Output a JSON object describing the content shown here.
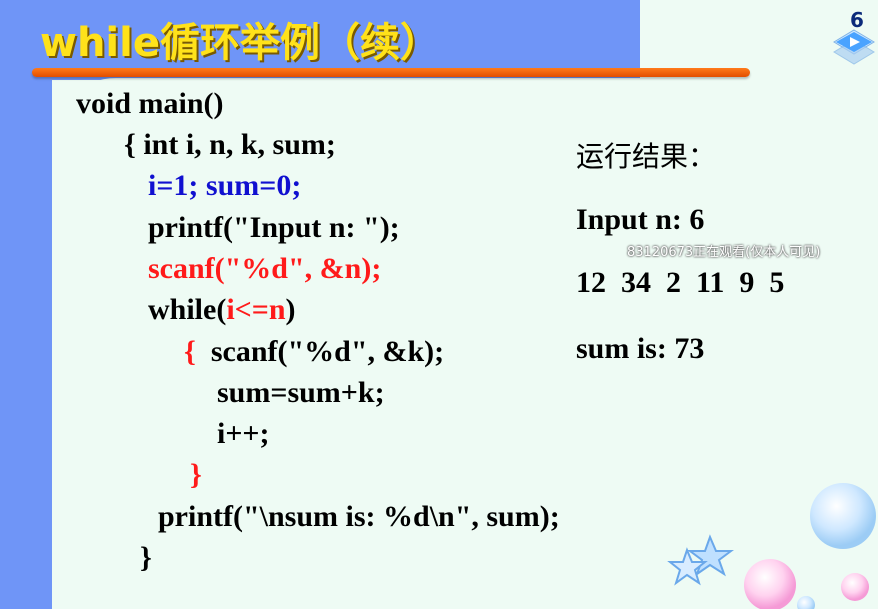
{
  "slide": {
    "title": "while循环举例（续）",
    "page_number": "6"
  },
  "code": {
    "line1": "void main()",
    "line2": "{ int i, n, k, sum;",
    "line3": "i=1; sum=0;",
    "line4": "printf(\"Input n: \");",
    "line5": "scanf(\"%d\", &n);",
    "line6_prefix": "while(",
    "line6_cond": "i<=n",
    "line6_suffix": ")",
    "line7_brace": "{",
    "line7_rest": "  scanf(\"%d\", &k);",
    "line8": "sum=sum+k;",
    "line9": "i++;",
    "line10": "}",
    "line11": "printf(\"\\nsum is: %d\\n\", sum);",
    "line12": "}"
  },
  "result": {
    "heading": "运行结果：",
    "input_line": "Input n: 6",
    "numbers_line": "12  34  2  11  9  5",
    "sum_line": "sum is: 73"
  },
  "overlay": {
    "watermark": "83120673正在观看(仅本人可见)"
  },
  "colors": {
    "band": "#6f95f7",
    "title": "#ffe21a",
    "underline": "#ff7a1a",
    "keyword_blue": "#1010d0",
    "keyword_red": "#ff1a1a",
    "background": "#eefbf4"
  },
  "icons": [
    "next-slide-icon",
    "star-decoration-icon",
    "bubble-decoration-icon"
  ]
}
